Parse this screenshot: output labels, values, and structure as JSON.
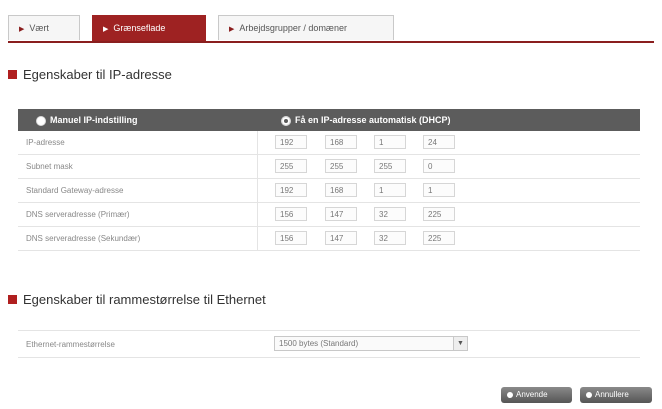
{
  "tabs": [
    {
      "label": "Vært",
      "active": false
    },
    {
      "label": "Grænseflade",
      "active": true
    },
    {
      "label": "Arbejdsgrupper / domæner",
      "active": false
    }
  ],
  "ip_section": {
    "title": "Egenskaber til IP-adresse",
    "option_manual": "Manuel IP-indstilling",
    "option_dhcp": "Få en IP-adresse automatisk (DHCP)",
    "rows": [
      {
        "label": "IP-adresse",
        "values": [
          "192",
          "168",
          "1",
          "24"
        ]
      },
      {
        "label": "Subnet mask",
        "values": [
          "255",
          "255",
          "255",
          "0"
        ]
      },
      {
        "label": "Standard Gateway-adresse",
        "values": [
          "192",
          "168",
          "1",
          "1"
        ]
      },
      {
        "label": "DNS serveradresse (Primær)",
        "values": [
          "156",
          "147",
          "32",
          "225"
        ]
      },
      {
        "label": "DNS serveradresse (Sekundær)",
        "values": [
          "156",
          "147",
          "32",
          "225"
        ]
      }
    ]
  },
  "ethernet_section": {
    "title": "Egenskaber til rammestørrelse til Ethernet",
    "field_label": "Ethernet-rammestørrelse",
    "selected_value": "1500 bytes (Standard)"
  },
  "buttons": {
    "apply": "Anvende",
    "cancel": "Annullere"
  },
  "colors": {
    "accent": "#9e2222",
    "table_header": "#5c5c5c"
  }
}
